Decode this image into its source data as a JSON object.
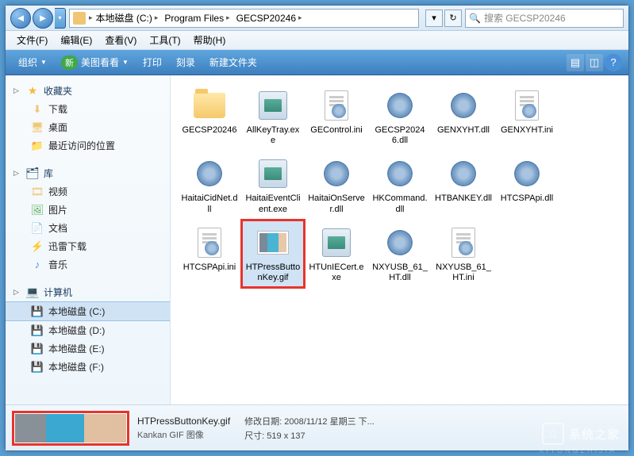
{
  "breadcrumb": [
    "本地磁盘 (C:)",
    "Program Files",
    "GECSP20246"
  ],
  "search": {
    "placeholder": "搜索 GECSP20246"
  },
  "menu": {
    "file": "文件(F)",
    "edit": "编辑(E)",
    "view": "查看(V)",
    "tools": "工具(T)",
    "help": "帮助(H)"
  },
  "toolbar": {
    "organize": "组织",
    "meitu_badge": "新",
    "meitu": "美图看看",
    "print": "打印",
    "burn": "刻录",
    "newfolder": "新建文件夹"
  },
  "sidebar": {
    "favorites": {
      "label": "收藏夹",
      "items": [
        {
          "label": "下载",
          "icon": "download"
        },
        {
          "label": "桌面",
          "icon": "desktop"
        },
        {
          "label": "最近访问的位置",
          "icon": "recent"
        }
      ]
    },
    "libraries": {
      "label": "库",
      "items": [
        {
          "label": "视频",
          "icon": "video"
        },
        {
          "label": "图片",
          "icon": "picture"
        },
        {
          "label": "文档",
          "icon": "document"
        },
        {
          "label": "迅雷下载",
          "icon": "thunder"
        },
        {
          "label": "音乐",
          "icon": "music"
        }
      ]
    },
    "computer": {
      "label": "计算机",
      "items": [
        {
          "label": "本地磁盘 (C:)",
          "icon": "drive",
          "selected": true
        },
        {
          "label": "本地磁盘 (D:)",
          "icon": "drive"
        },
        {
          "label": "本地磁盘 (E:)",
          "icon": "drive"
        },
        {
          "label": "本地磁盘 (F:)",
          "icon": "drive"
        }
      ]
    }
  },
  "files": [
    {
      "name": "GECSP20246",
      "type": "folder"
    },
    {
      "name": "AllKeyTray.exe",
      "type": "exe"
    },
    {
      "name": "GEControl.ini",
      "type": "ini"
    },
    {
      "name": "GECSP20246.dll",
      "type": "dll"
    },
    {
      "name": "GENXYHT.dll",
      "type": "dll"
    },
    {
      "name": "GENXYHT.ini",
      "type": "ini"
    },
    {
      "name": "HaitaiCidNet.dll",
      "type": "dll"
    },
    {
      "name": "HaitaiEventClient.exe",
      "type": "exe"
    },
    {
      "name": "HaitaiOnServer.dll",
      "type": "dll"
    },
    {
      "name": "HKCommand.dll",
      "type": "dll"
    },
    {
      "name": "HTBANKEY.dll",
      "type": "dll"
    },
    {
      "name": "HTCSPApi.dll",
      "type": "dll"
    },
    {
      "name": "HTCSPApi.ini",
      "type": "ini"
    },
    {
      "name": "HTPressButtonKey.gif",
      "type": "gif",
      "selected": true,
      "highlight": true
    },
    {
      "name": "HTUnIECert.exe",
      "type": "exe"
    },
    {
      "name": "NXYUSB_61_HT.dll",
      "type": "dll"
    },
    {
      "name": "NXYUSB_61_HT.ini",
      "type": "ini"
    }
  ],
  "details": {
    "filename": "HTPressButtonKey.gif",
    "filetype": "Kankan GIF 图像",
    "date_label": "修改日期:",
    "date_value": "2008/11/12 星期三 下...",
    "size_label": "尺寸:",
    "size_value": "519 x 137"
  },
  "watermark": "系统之家",
  "watermark_sub": "XITONGZHIJIA"
}
